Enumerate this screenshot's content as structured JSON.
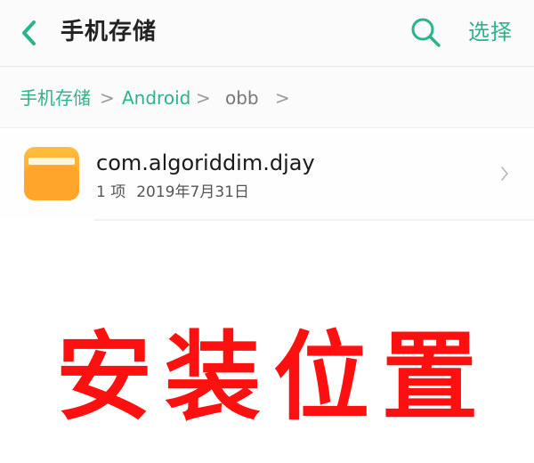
{
  "header": {
    "title": "手机存储",
    "select_label": "选择",
    "back_icon": "chevron-left-icon",
    "search_icon": "search-icon"
  },
  "breadcrumb": {
    "items": [
      "手机存储",
      "Android",
      "obb"
    ],
    "separator": ">"
  },
  "files": [
    {
      "name": "com.algoriddim.djay",
      "count": "1 项",
      "date": "2019年7月31日",
      "icon": "folder-icon"
    }
  ],
  "overlay": {
    "caption": "安装位置"
  },
  "colors": {
    "accent": "#2bb38c",
    "caption": "#ff1010",
    "folder": "#ffa52a"
  }
}
